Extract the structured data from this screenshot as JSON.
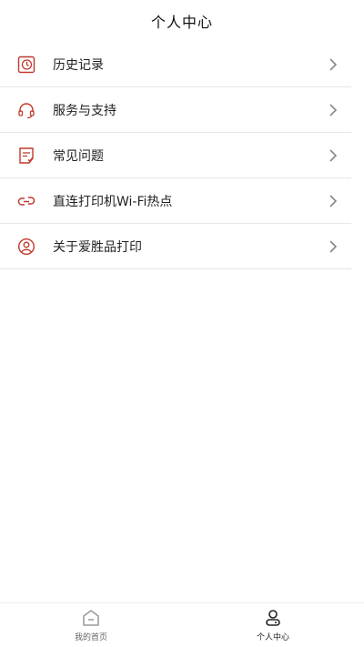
{
  "header": {
    "title": "个人中心"
  },
  "menu": {
    "items": [
      {
        "label": "历史记录",
        "icon": "history-icon"
      },
      {
        "label": "服务与支持",
        "icon": "headset-icon"
      },
      {
        "label": "常见问题",
        "icon": "faq-icon"
      },
      {
        "label": "直连打印机Wi-Fi热点",
        "icon": "link-icon"
      },
      {
        "label": "关于爱胜品打印",
        "icon": "user-icon"
      }
    ]
  },
  "tabbar": {
    "tabs": [
      {
        "label": "我的首页",
        "icon": "home-icon",
        "active": false
      },
      {
        "label": "个人中心",
        "icon": "profile-icon",
        "active": true
      }
    ]
  },
  "colors": {
    "accent": "#c0392b",
    "divider": "#e6e6e6",
    "chevron": "#888888"
  }
}
